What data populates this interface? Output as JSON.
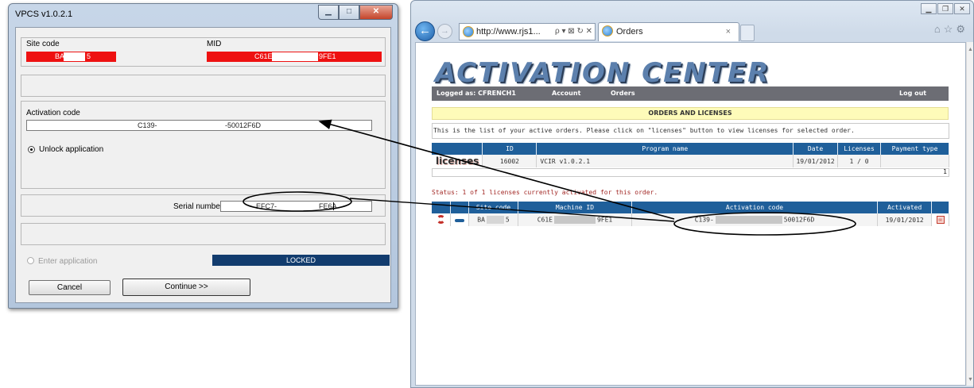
{
  "vpcs": {
    "title": "VPCS v1.0.2.1",
    "site_code_label": "Site code",
    "site_code_start": "BA",
    "site_code_end": "5",
    "mid_label": "MID",
    "mid_start": "C61E",
    "mid_end": "9FE1",
    "activation_code_label": "Activation code",
    "activation_code_start": "C139-",
    "activation_code_end": "-50012F6D",
    "unlock_option": "Unlock application",
    "serial_number_label": "Serial number",
    "serial_start": "EFC7-",
    "serial_end": "FE6A",
    "enter_option": "Enter application",
    "status": "LOCKED",
    "cancel_button": "Cancel",
    "continue_button": "Continue >>"
  },
  "browser": {
    "address": "http://www.rjs1...",
    "address_tools": "ρ ▾ ⊠ ↻ ✕",
    "tab_title": "Orders",
    "tab_close": "×",
    "page": {
      "logo": "ACTIVATION CENTER",
      "logged_as": "Logged as: CFRENCH1",
      "menu_account": "Account",
      "menu_orders": "Orders",
      "menu_logout": "Log out",
      "section_title": "ORDERS AND LICENSES",
      "info_text": "This is the list of your active orders. Please click on \"licenses\" button to view licenses for selected order.",
      "orders_table": {
        "headers": [
          "ID",
          "Program name",
          "Date",
          "Licenses",
          "Payment type"
        ],
        "link_label": "licenses",
        "row": {
          "id": "16002",
          "program": "VCIR v1.0.2.1",
          "date": "19/01/2012",
          "licenses": "1 / 0",
          "payment": ""
        }
      },
      "pager": "1",
      "status_prefix": "Status:",
      "status_text": "1 of 1 licenses currently activated for this order.",
      "licenses_table": {
        "headers": [
          "Site code",
          "Machine ID",
          "Activation code",
          "Activated"
        ],
        "row": {
          "site_start": "BA",
          "site_end": "5",
          "machine_start": "C61E",
          "machine_end": "9FE1",
          "code_start": "C139-",
          "code_end": "50012F6D",
          "activated": "19/01/2012"
        }
      }
    }
  },
  "colors": {
    "header_blue": "#1f5f9a",
    "field_red": "#ee1111",
    "locked_navy": "#123c6e",
    "banner_yellow": "#fefbb9",
    "licenses_red": "#c2342d"
  },
  "icons": [
    "back-arrow-icon",
    "forward-arrow-icon",
    "ie-page-icon",
    "home-icon",
    "favorites-star-icon",
    "tools-gear-icon",
    "refresh-cycle-icon",
    "key-icon",
    "document-icon"
  ]
}
